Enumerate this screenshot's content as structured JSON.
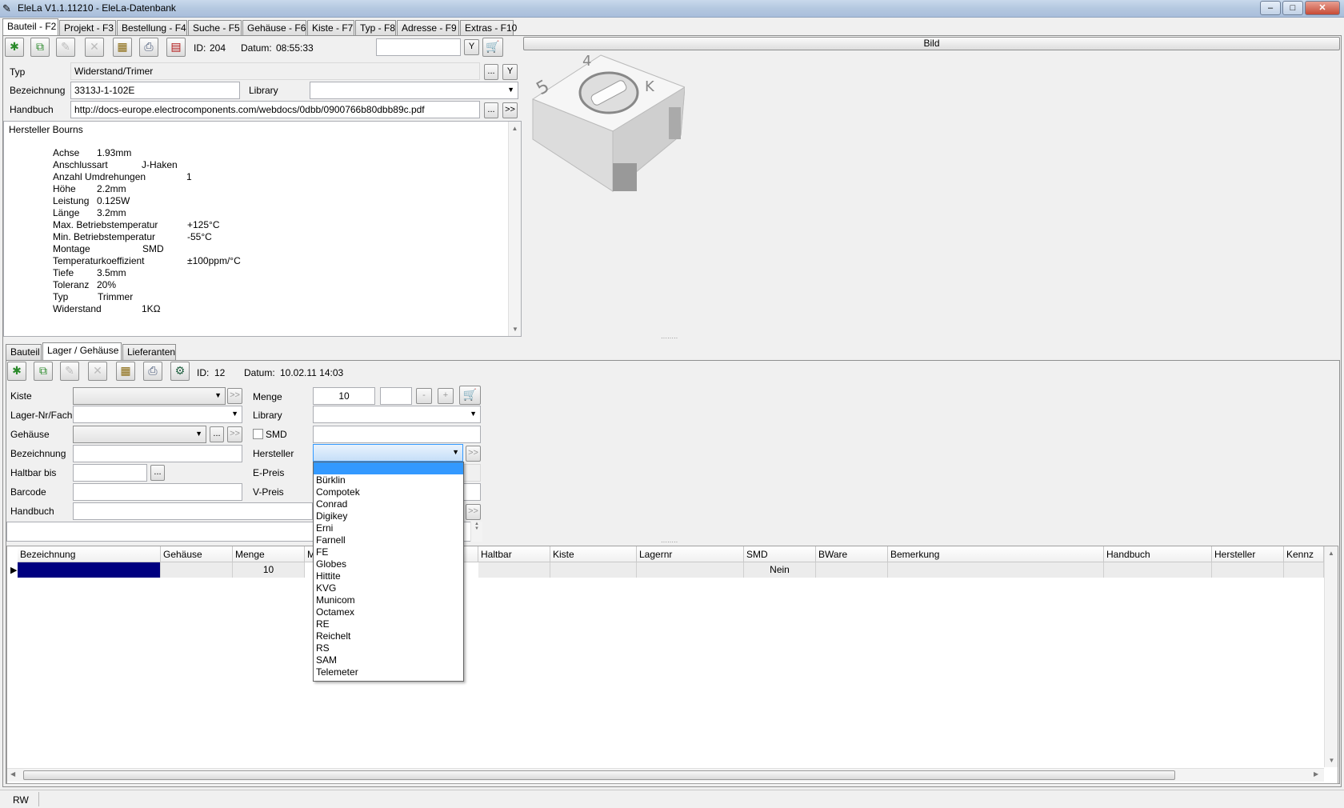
{
  "window": {
    "title": "EleLa V1.1.11210  - EleLa-Datenbank",
    "minimize": "–",
    "maximize": "□",
    "close": "✕"
  },
  "main_tabs": [
    {
      "label": "Bauteil - F2"
    },
    {
      "label": "Projekt - F3"
    },
    {
      "label": "Bestellung - F4"
    },
    {
      "label": "Suche - F5"
    },
    {
      "label": "Gehäuse - F6"
    },
    {
      "label": "Kiste - F7"
    },
    {
      "label": "Typ - F8"
    },
    {
      "label": "Adresse - F9"
    },
    {
      "label": "Extras - F10"
    }
  ],
  "bauteil": {
    "id_label": "ID:",
    "id_value": "204",
    "datum_label": "Datum:",
    "datum_value": "08:55:33",
    "filter_btn": "Y",
    "typ_label": "Typ",
    "typ_value": "Widerstand/Trimer",
    "bezeichnung_label": "Bezeichnung",
    "bezeichnung_value": "3313J-1-102E",
    "library_label": "Library",
    "library_value": "",
    "handbuch_label": "Handbuch",
    "handbuch_value": "http://docs-europe.electrocomponents.com/webdocs/0dbb/0900766b80dbb89c.pdf",
    "dots_btn": "...",
    "go_btn": ">>",
    "bild_label": "Bild",
    "hersteller_line": "Hersteller Bourns",
    "properties": [
      {
        "name": "Achse",
        "value": "1.93mm"
      },
      {
        "name": "Anschlussart",
        "value": "J-Haken"
      },
      {
        "name": "Anzahl Umdrehungen",
        "value": "1"
      },
      {
        "name": "Höhe",
        "value": "2.2mm"
      },
      {
        "name": "Leistung",
        "value": "0.125W"
      },
      {
        "name": "Länge",
        "value": "3.2mm"
      },
      {
        "name": "Max. Betriebstemperatur",
        "value": "+125°C"
      },
      {
        "name": "Min. Betriebstemperatur",
        "value": "-55°C"
      },
      {
        "name": "Montage",
        "value": "SMD"
      },
      {
        "name": "Temperaturkoeffizient",
        "value": "±100ppm/°C"
      },
      {
        "name": "Tiefe",
        "value": "3.5mm"
      },
      {
        "name": "Toleranz",
        "value": "20%"
      },
      {
        "name": "Typ",
        "value": "Trimmer"
      },
      {
        "name": "Widerstand",
        "value": "1KΩ"
      }
    ]
  },
  "sub_tabs": [
    {
      "label": "Bauteil"
    },
    {
      "label": "Lager / Gehäuse"
    },
    {
      "label": "Lieferanten"
    }
  ],
  "lager": {
    "id_label": "ID:",
    "id_value": "12",
    "datum_label": "Datum:",
    "datum_value": "10.02.11 14:03",
    "kiste_label": "Kiste",
    "lagernr_label": "Lager-Nr/Fach",
    "gehaeuse_label": "Gehäuse",
    "bezeichnung_label": "Bezeichnung",
    "haltbar_label": "Haltbar bis",
    "barcode_label": "Barcode",
    "handbuch_label": "Handbuch",
    "menge_label": "Menge",
    "menge_value": "10",
    "minus": "-",
    "plus": "+",
    "library_label": "Library",
    "smd_label": "SMD",
    "hersteller_label": "Hersteller",
    "epreis_label": "E-Preis",
    "vpreis_label": "V-Preis",
    "hersteller_options": [
      "",
      "Bürklin",
      "Compotek",
      "Conrad",
      "Digikey",
      "Erni",
      "Farnell",
      "FE",
      "Globes",
      "Hittite",
      "KVG",
      "Municom",
      "Octamex",
      "RE",
      "Reichelt",
      "RS",
      "SAM",
      "Telemeter"
    ]
  },
  "grid": {
    "columns": [
      "Bezeichnung",
      "Gehäuse",
      "Menge",
      "M",
      "Haltbar",
      "Kiste",
      "Lagernr",
      "SMD",
      "BWare",
      "Bemerkung",
      "Handbuch",
      "Hersteller",
      "Kennz"
    ],
    "rows": [
      {
        "bezeichnung": "",
        "gehaeuse": "",
        "menge": "10",
        "smd": "Nein"
      }
    ]
  },
  "status": {
    "mode": "RW"
  },
  "colors": {
    "selection": "#000080",
    "dropdown_highlight": "#3399ff"
  }
}
